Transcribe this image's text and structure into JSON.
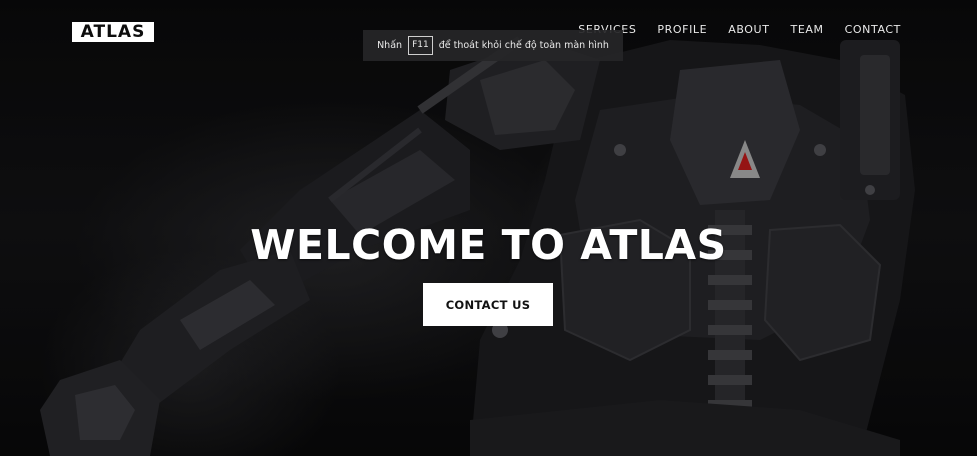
{
  "brand": {
    "logo_text": "ATLAS"
  },
  "nav": {
    "items": [
      {
        "label": "SERVICES"
      },
      {
        "label": "PROFILE"
      },
      {
        "label": "ABOUT"
      },
      {
        "label": "TEAM"
      },
      {
        "label": "CONTACT"
      }
    ]
  },
  "fullscreen_notice": {
    "prefix": "Nhấn",
    "key": "F11",
    "suffix": "để thoát khỏi chế độ toàn màn hình"
  },
  "hero": {
    "headline": "WELCOME TO ATLAS",
    "cta_label": "CONTACT US"
  },
  "colors": {
    "background": "#060606",
    "text": "#ffffff",
    "cta_background": "#ffffff",
    "cta_text": "#111111",
    "armor_highlight": "#cf1d1d"
  }
}
